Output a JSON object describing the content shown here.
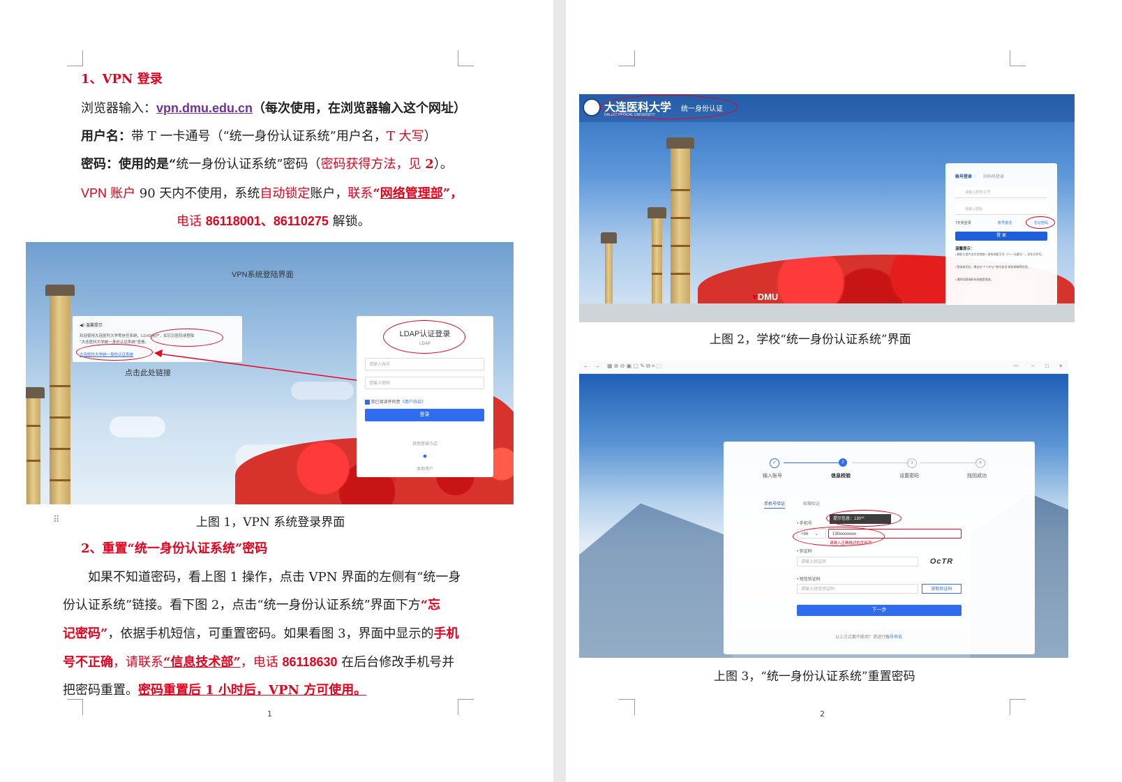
{
  "page1": {
    "s1_title": "1、VPN 登录",
    "l1_prefix": "浏览器输入：",
    "l1_url": "vpn.dmu.edu.cn",
    "l1_note": "（每次使用，在浏览器输入这个网址）",
    "l2_label": "用户名：",
    "l2_text_a": "带 T 一卡通号（“统一身份认证系统”用户名，",
    "l2_red": "T 大写",
    "l2_text_b": "）",
    "l3_label": "密码：使用的是“",
    "l3_text_a": "统一身份认证系统",
    "l3_text_b": "”密码（",
    "l3_red": "密码获得方法，见 ",
    "l3_red_num": "2",
    "l3_end": "）。",
    "l4_a": "VPN 账户",
    "l4_b": " 90 天内不使用，系统",
    "l4_c": "自动锁定",
    "l4_d": "账户，",
    "l4_e": "联系",
    "l4_f": "“",
    "l4_g": "网络管理部",
    "l4_h": "”，",
    "l5_a": "电话 ",
    "l5_b": "86118001、86110275",
    "l5_c": " 解锁。",
    "fig1": {
      "header": "VPN系统登陆界面",
      "notice_title": "温馨提示",
      "notice_text_a": "欢迎使用大连医科大学零信任系统，",
      "notice_highlight": "LDAP用户，如忘记密码请登陆",
      "notice_text_b": "“大连医科大学统一身份认证系统”查看。",
      "notice_link": "大连医科大学统一身份认证系统",
      "click_hint": "点击此处链接",
      "login_title": "LDAP认证登录",
      "login_sub": "LDAP",
      "account_placeholder": "请输入账号",
      "password_placeholder": "请输入密码",
      "agree_text": "我已阅读并同意",
      "agree_link": "《用户协议》",
      "login_button": "登录",
      "other_methods": "其他登录方式",
      "local_account": "本地用户"
    },
    "cap1": "上图 1，VPN 系统登录界面",
    "s2_title": "2、重置“统一身份认证系统”密码",
    "b1": "如果不知道密码，看上图 1 操作，点击 VPN 界面的左侧有“统一身",
    "b2_a": "份认证系统”链接。看下图 2，点击“统一身份认证系统”界面下方",
    "b2_red": "“忘",
    "b3_red": "记密码”",
    "b3_a": "，依据手机短信，可重置密码。如果看图 3，界面中显示的",
    "b3_red2": "手机",
    "b4_red": "号不正确",
    "b4_a": "，",
    "b4_b": "请联系",
    "b4_c": "“信息技术部”",
    "b4_d": "，电话 ",
    "b4_e": "86118630",
    "b4_f": " 在后台修改手机号并",
    "b5_a": "把密码重置。",
    "b5_red": "密码重置后 1 小时后，VPN 方可使用。",
    "page_num": "1"
  },
  "page2": {
    "fig2": {
      "logo": "大连医科大学",
      "logo_sub": "统一身份认证",
      "logo_en": "DALIAN MEDICAL UNIVERSITY",
      "tab_account": "账号登录",
      "tab_scan": "扫码码登录",
      "user_placeholder": "请输入学号/工号",
      "pwd_placeholder": "请输入密码",
      "remember": "7天免登录",
      "retrieve": "账号激活",
      "forgot": "忘记密码",
      "login_button": "登 录",
      "tips_title": "温馨提示：",
      "tip1": "• 教职工用户名为学院统一发布的职工号（T+一卡通号），学生为学号。",
      "tip2": "• 登录成功后，建议在“个人中心”“账号安全”绑定邮箱等信息。",
      "tip3": "• 遇到问题请联系网络管理部。",
      "dmu": "DMU"
    },
    "cap2": "上图 2，学校“统一身份认证系统”界面",
    "fig3": {
      "steps": [
        "输入账号",
        "信息校验",
        "设置密码",
        "找回成功"
      ],
      "tab_phone": "手机号验证",
      "tab_email": "邮箱验证",
      "phone_label": "• 手机号",
      "tooltip": "提示信息：130**",
      "country_code": "+86",
      "phone_value": "130xxxxxxxx",
      "phone_error": "请输入正确格式的手机号",
      "captcha_label": "• 验证码",
      "captcha_placeholder": "请输入验证码",
      "captcha_image": "OcTR",
      "sms_label": "• 短信验证码",
      "sms_placeholder": "请输入短信验证码",
      "sms_button": "获取验证码",
      "next_button": "下一步",
      "footer_a": "以上方式都不能用？请进行",
      "footer_link": "账号申诉"
    },
    "cap3": "上图 3，“统一身份认证系统”重置密码",
    "page_num": "2"
  }
}
